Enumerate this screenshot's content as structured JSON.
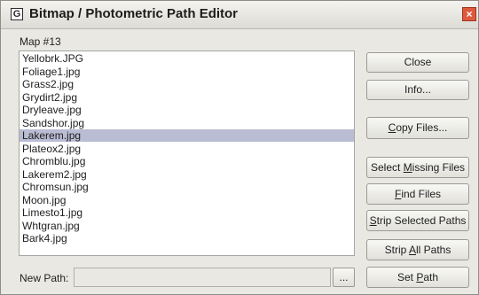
{
  "window": {
    "title": "Bitmap / Photometric Path Editor",
    "icon_glyph": "G",
    "close_glyph": "×"
  },
  "map_label": "Map #13",
  "files": [
    "Yellobrk.JPG",
    "Foliage1.jpg",
    "Grass2.jpg",
    "Grydirt2.jpg",
    "Dryleave.jpg",
    "Sandshor.jpg",
    "Lakerem.jpg",
    "Plateox2.jpg",
    "Chromblu.jpg",
    "Lakerem2.jpg",
    "Chromsun.jpg",
    "Moon.jpg",
    "Limesto1.jpg",
    "Whtgran.jpg",
    "Bark4.jpg"
  ],
  "selected_file": "Lakerem.jpg",
  "buttons": {
    "close": "Close",
    "info": "Info...",
    "copy_files": {
      "pre": "",
      "key": "C",
      "post": "opy Files..."
    },
    "select_missing": {
      "pre": "Select ",
      "key": "M",
      "post": "issing Files"
    },
    "find_files": {
      "pre": "",
      "key": "F",
      "post": "ind Files"
    },
    "strip_selected": {
      "pre": "",
      "key": "S",
      "post": "trip Selected Paths"
    },
    "strip_all": {
      "pre": "Strip ",
      "key": "A",
      "post": "ll Paths"
    },
    "set_path": {
      "pre": "Set ",
      "key": "P",
      "post": "ath"
    }
  },
  "new_path": {
    "label": "New Path:",
    "value": "",
    "browse_label": "..."
  },
  "colors": {
    "selection": "#b9bcd3",
    "close_button": "#dd5a3e"
  }
}
